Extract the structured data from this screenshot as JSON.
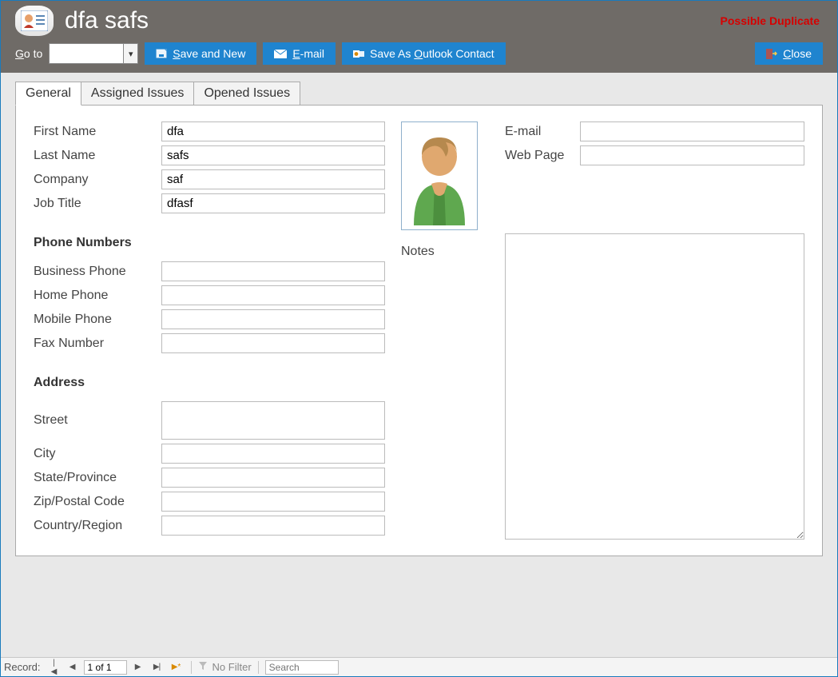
{
  "header": {
    "title": "dfa safs",
    "duplicate_warning": "Possible Duplicate",
    "goto_label_pre": "G",
    "goto_label_post": "o to",
    "goto_value": "",
    "buttons": {
      "save_new_pre": "S",
      "save_new_post": "ave and New",
      "email_pre": "E",
      "email_post": "-mail",
      "outlook_pre": "Save As ",
      "outlook_ul": "O",
      "outlook_post": "utlook Contact",
      "close_pre": "C",
      "close_post": "lose"
    }
  },
  "tabs": {
    "general": "General",
    "assigned": "Assigned Issues",
    "opened": "Opened Issues"
  },
  "fields": {
    "first_name_label": "First Name",
    "first_name": "dfa",
    "last_name_label": "Last Name",
    "last_name": "safs",
    "company_label": "Company",
    "company": "saf",
    "job_title_label": "Job Title",
    "job_title": "dfasf",
    "phone_section": "Phone Numbers",
    "business_phone_label": "Business Phone",
    "business_phone": "",
    "home_phone_label": "Home Phone",
    "home_phone": "",
    "mobile_phone_label": "Mobile Phone",
    "mobile_phone": "",
    "fax_label": "Fax Number",
    "fax": "",
    "address_section": "Address",
    "street_label": "Street",
    "street": "",
    "city_label": "City",
    "city": "",
    "state_label": "State/Province",
    "state": "",
    "zip_label": "Zip/Postal Code",
    "zip": "",
    "country_label": "Country/Region",
    "country": ""
  },
  "right": {
    "email_label": "E-mail",
    "email": "",
    "web_label": "Web Page",
    "web": "",
    "notes_label": "Notes",
    "notes": ""
  },
  "status": {
    "record_label": "Record:",
    "record_pos": "1 of 1",
    "no_filter": "No Filter",
    "search_placeholder": "Search"
  }
}
